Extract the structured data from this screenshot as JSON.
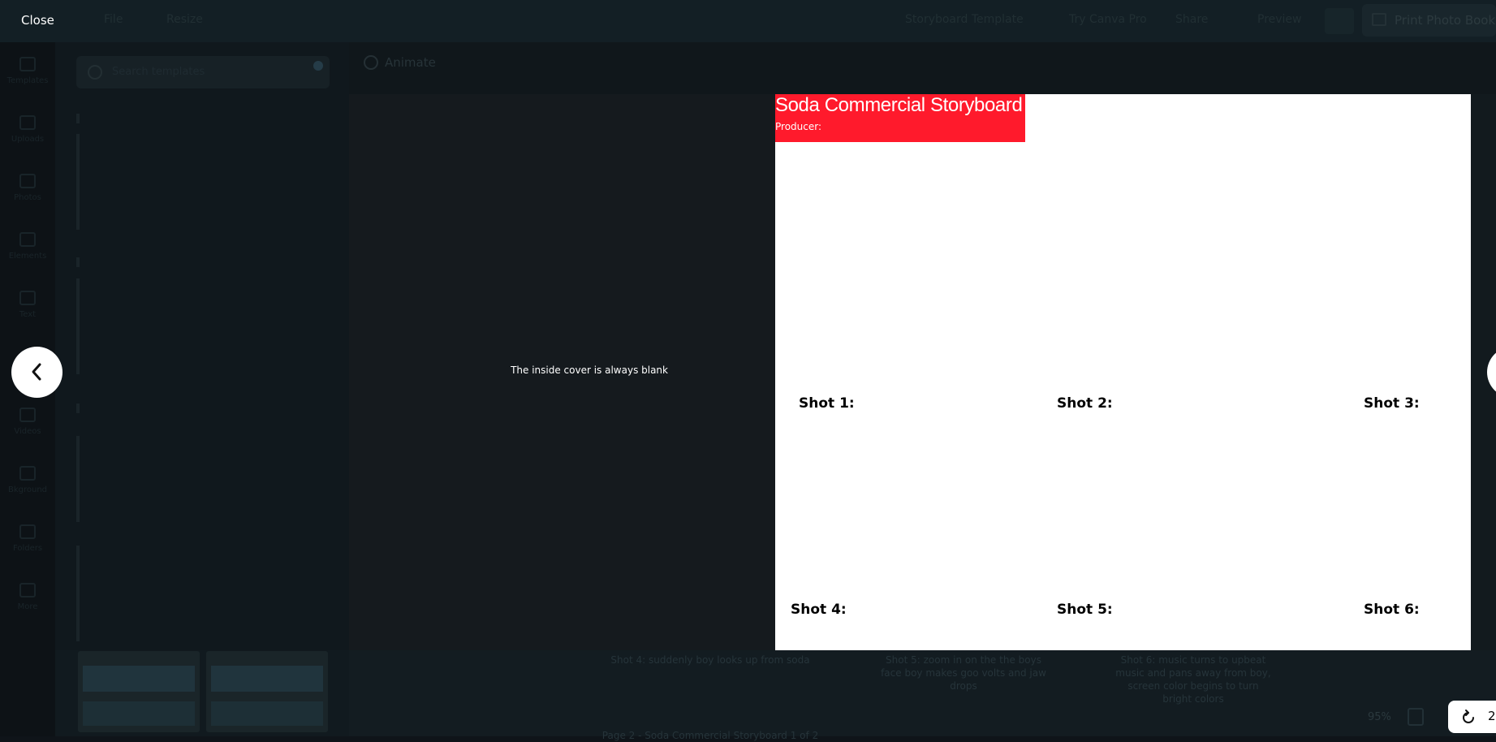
{
  "editor": {
    "menu_ghost": [
      "File",
      "Resize"
    ],
    "title_ghost": "Storyboard Template",
    "pro_ghost": "Try Canva Pro",
    "share_ghost": "Share",
    "preview_ghost": "Preview",
    "print_label": "Print Photo Books",
    "rail": [
      "Templates",
      "Uploads",
      "Photos",
      "Elements",
      "Text",
      "Videos",
      "Bkground",
      "Folders",
      "More"
    ],
    "search_placeholder": "Search templates",
    "animate_label": "Animate",
    "zoom": "95%",
    "under_shot4": "Shot 4: suddenly boy looks up from soda",
    "under_shot5": "Shot 5: zoom in on the the boys face boy makes goo volts and jaw drops",
    "under_shot6": "Shot 6: music turns to upbeat music and pans away from boy, screen color begins to turn bright colors",
    "page_caption": "Page 2 - Soda Commercial Storyboard 1 of 2"
  },
  "preview": {
    "close_label": "Close",
    "inside_cover_text": "The inside cover is always blank",
    "page": {
      "title": "Soda Commercial Storyboard",
      "producer": "Producer:",
      "shots": [
        "Shot 1:",
        "Shot 2:",
        "Shot 3:",
        "Shot 4:",
        "Shot 5:",
        "Shot 6:"
      ]
    },
    "page_number": "2"
  },
  "colors": {
    "title_block": "#ff1a2c",
    "page_bg": "#ffffff",
    "backdrop": "#151a1e"
  },
  "icons": {
    "prev": "chevron-left-icon",
    "next": "chevron-right-icon",
    "rotate": "rotate-icon"
  }
}
